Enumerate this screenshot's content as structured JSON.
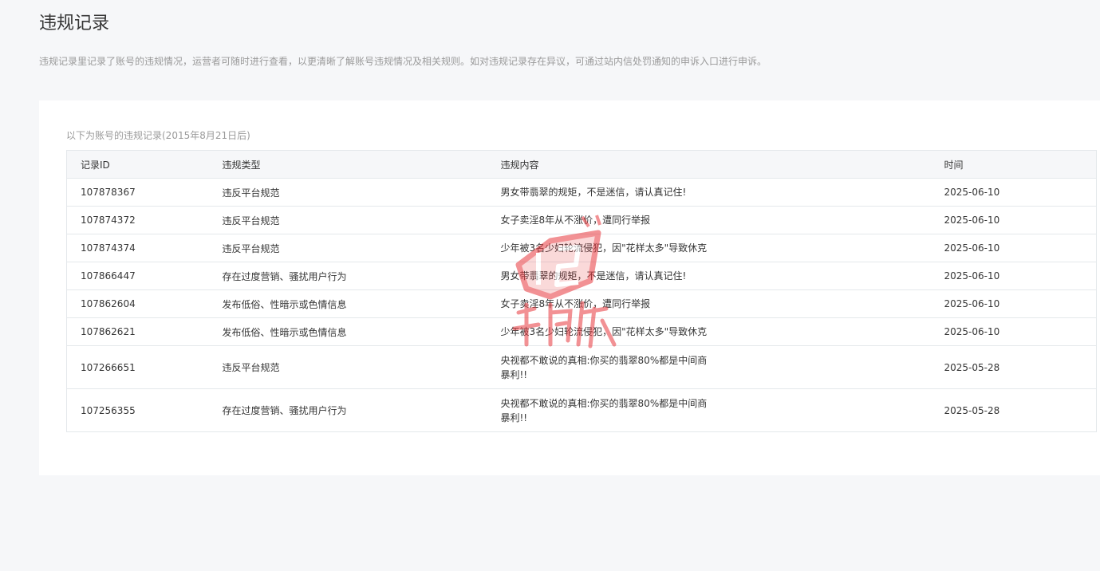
{
  "page": {
    "title": "违规记录",
    "description": "违规记录里记录了账号的违规情况，运营者可随时进行查看，以更清晰了解账号违规情况及相关规则。如对违规记录存在异议，可通过站内信处罚通知的申诉入口进行申诉。"
  },
  "table": {
    "caption": "以下为账号的违规记录(2015年8月21日后)",
    "headers": {
      "id": "记录ID",
      "type": "违规类型",
      "content": "违规内容",
      "time": "时间"
    },
    "rows": [
      {
        "id": "107878367",
        "type": "违反平台规范",
        "content": "男女带翡翠的规矩，不是迷信，请认真记住!",
        "time": "2025-06-10"
      },
      {
        "id": "107874372",
        "type": "违反平台规范",
        "content": "女子卖淫8年从不涨价，遭同行举报",
        "time": "2025-06-10"
      },
      {
        "id": "107874374",
        "type": "违反平台规范",
        "content": "少年被3名少妇轮流侵犯，因\"花样太多\"导致休克",
        "time": "2025-06-10"
      },
      {
        "id": "107866447",
        "type": "存在过度营销、骚扰用户行为",
        "content": "男女带翡翠的规矩，不是迷信，请认真记住!",
        "time": "2025-06-10"
      },
      {
        "id": "107862604",
        "type": "发布低俗、性暗示或色情信息",
        "content": "女子卖淫8年从不涨价，遭同行举报",
        "time": "2025-06-10"
      },
      {
        "id": "107862621",
        "type": "发布低俗、性暗示或色情信息",
        "content": "少年被3名少妇轮流侵犯，因\"花样太多\"导致休克",
        "time": "2025-06-10"
      },
      {
        "id": "107266651",
        "type": "违反平台规范",
        "content": "央视都不敢说的真相:你买的翡翠80%都是中间商暴利!!",
        "time": "2025-05-28"
      },
      {
        "id": "107256355",
        "type": "存在过度营销、骚扰用户行为",
        "content": "央视都不敢说的真相:你买的翡翠80%都是中间商暴利!!",
        "time": "2025-05-28"
      }
    ]
  },
  "watermark": {
    "icon": "watermark-logo-icon",
    "color": "#e8383d"
  }
}
